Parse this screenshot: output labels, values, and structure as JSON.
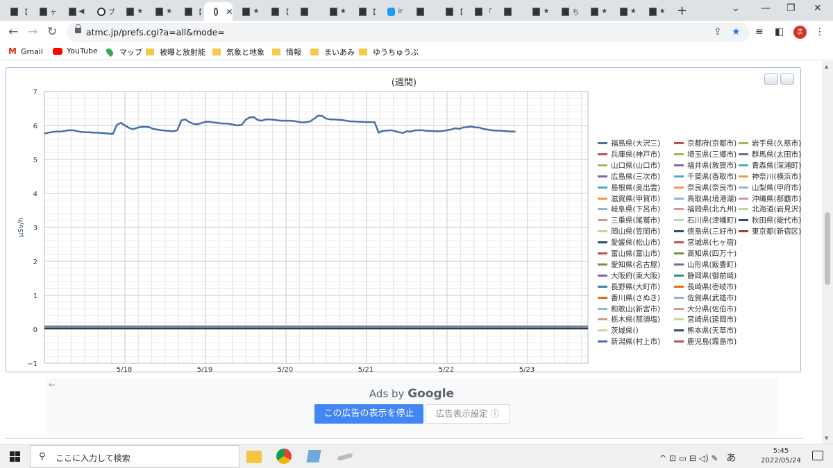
{
  "browser": {
    "tabs": [
      {
        "title": "【",
        "icon": "favicon-dark"
      },
      {
        "title": "ヶ",
        "icon": "favicon-dark"
      },
      {
        "title": "◀",
        "icon": "favicon-dark"
      },
      {
        "title": "ブ",
        "icon": "info-icon"
      },
      {
        "title": "★",
        "icon": "favicon-dark"
      },
      {
        "title": "★",
        "icon": "favicon-dark"
      },
      {
        "title": "【",
        "icon": "favicon-dark"
      },
      {
        "title": "",
        "icon": "globe-icon",
        "active": true
      },
      {
        "title": "★",
        "icon": "favicon-dark"
      },
      {
        "title": "【",
        "icon": "favicon-dark"
      },
      {
        "title": "",
        "icon": "favicon-dark"
      },
      {
        "title": "★",
        "icon": "favicon-dark"
      },
      {
        "title": "【",
        "icon": "favicon-dark"
      },
      {
        "title": "ir",
        "icon": "twitter-icon"
      },
      {
        "title": "",
        "icon": "favicon-dark"
      },
      {
        "title": "【",
        "icon": "favicon-dark"
      },
      {
        "title": "「",
        "icon": "favicon-dark"
      },
      {
        "title": "",
        "icon": "favicon-dark"
      },
      {
        "title": "★",
        "icon": "favicon-dark"
      },
      {
        "title": "ち",
        "icon": "favicon-dark"
      },
      {
        "title": "★",
        "icon": "favicon-dark"
      },
      {
        "title": "★",
        "icon": "favicon-dark"
      },
      {
        "title": "★",
        "icon": "favicon-dark"
      }
    ],
    "new_tab": "+",
    "window_controls": {
      "minimize": "⌄",
      "minimize2": "—",
      "restore": "❐",
      "close": "✕"
    },
    "url": "atmc.jp/prefs.cgi?a=all&mode=",
    "profile_initial": "ま",
    "bookmarks": [
      {
        "label": "Gmail",
        "icon": "gmail-icon"
      },
      {
        "label": "YouTube",
        "icon": "youtube-icon"
      },
      {
        "label": "マップ",
        "icon": "maps-icon"
      },
      {
        "label": "被曝と放射能",
        "icon": "folder-icon"
      },
      {
        "label": "気象と地象",
        "icon": "folder-icon"
      },
      {
        "label": "情報",
        "icon": "folder-icon"
      },
      {
        "label": "まいあみ",
        "icon": "folder-icon"
      },
      {
        "label": "ゆうちゅうぶ",
        "icon": "folder-icon"
      }
    ]
  },
  "chart_data": {
    "type": "line",
    "title": "(週間)",
    "ylabel": "μSv/h",
    "ylim": [
      -1,
      7
    ],
    "yticks": [
      "7",
      "6",
      "5",
      "4",
      "3",
      "2",
      "1",
      "0",
      "−1"
    ],
    "xticks": [
      "5/18",
      "5/19",
      "5/20",
      "5/21",
      "5/22",
      "5/23"
    ],
    "grid": true,
    "legend_position": "right",
    "main_series": {
      "name": "福島県(大沢三)",
      "color": "#4a6fa5",
      "x": [
        0,
        0.05,
        0.1,
        0.15,
        0.2,
        0.25,
        0.3,
        0.35,
        0.4,
        0.45,
        0.5,
        0.55,
        0.6,
        0.65,
        0.7,
        0.75,
        0.8,
        0.85,
        0.9,
        0.95,
        1.0,
        1.05,
        1.1,
        1.15,
        1.2,
        1.25,
        1.3,
        1.35,
        1.4,
        1.45,
        1.5,
        1.55,
        1.6,
        1.65,
        1.7,
        1.75,
        1.8,
        1.85,
        1.9,
        1.95,
        2.0,
        2.05,
        2.1,
        2.15,
        2.2,
        2.25,
        2.3,
        2.35,
        2.4,
        2.45,
        2.5,
        2.55,
        2.6,
        2.65,
        2.7,
        2.75,
        2.8,
        2.85,
        2.9,
        2.95,
        3.0,
        3.05,
        3.1,
        3.15,
        3.2,
        3.25,
        3.3,
        3.35,
        3.4,
        3.45,
        3.5,
        3.55,
        3.6,
        3.65,
        3.7,
        3.75,
        3.8,
        3.85,
        3.9,
        3.95,
        4.0,
        4.05,
        4.1,
        4.15,
        4.2,
        4.25,
        4.3,
        4.35,
        4.4,
        4.45,
        4.5,
        4.55,
        4.6,
        4.65,
        4.7,
        4.75,
        4.8,
        4.85,
        4.9,
        4.95,
        5.0,
        5.05,
        5.1,
        5.15,
        5.2,
        5.25,
        5.3,
        5.35,
        5.4,
        5.45,
        5.5,
        5.55,
        5.6,
        5.65,
        5.7,
        5.75,
        5.8,
        5.85,
        5.9,
        5.95,
        6.0,
        6.05,
        6.1,
        6.15,
        6.2,
        6.25,
        6.3,
        6.35,
        6.4,
        6.45,
        6.5,
        6.55,
        6.6,
        6.65,
        6.7
      ],
      "y": [
        5.76,
        5.79,
        5.81,
        5.82,
        5.82,
        5.84,
        5.86,
        5.86,
        5.84,
        5.81,
        5.8,
        5.8,
        5.79,
        5.79,
        5.78,
        5.77,
        5.76,
        5.75,
        6.02,
        6.08,
        6.0,
        5.93,
        5.89,
        5.93,
        5.96,
        5.96,
        5.95,
        5.9,
        5.88,
        5.86,
        5.85,
        5.84,
        5.83,
        5.86,
        6.15,
        6.18,
        6.1,
        6.05,
        6.04,
        6.07,
        6.11,
        6.11,
        6.09,
        6.08,
        6.06,
        6.06,
        6.05,
        6.02,
        6.0,
        6.02,
        6.17,
        6.24,
        6.25,
        6.16,
        6.14,
        6.18,
        6.18,
        6.17,
        6.15,
        6.14,
        6.14,
        6.14,
        6.13,
        6.11,
        6.09,
        6.1,
        6.12,
        6.2,
        6.29,
        6.28,
        6.2,
        6.18,
        6.18,
        6.17,
        6.16,
        6.14,
        6.12,
        6.12,
        6.11,
        6.11,
        6.1,
        6.1,
        6.1,
        5.79,
        5.84,
        5.85,
        5.86,
        5.84,
        5.8,
        5.78,
        5.83,
        5.82,
        5.86,
        5.86,
        5.86,
        5.84,
        5.84,
        5.83,
        5.83,
        5.84,
        5.86,
        5.88,
        5.92,
        5.9,
        5.94,
        5.95,
        5.97,
        5.94,
        5.94,
        5.9,
        5.88,
        5.86,
        5.85,
        5.85,
        5.84,
        5.83,
        5.82,
        5.82
      ],
      "x_domain": [
        0,
        6.75
      ],
      "x_tick_positions": [
        1,
        2,
        3,
        4,
        5,
        6
      ]
    },
    "near_zero_series_colors": [
      "#c0504d",
      "#9bbb59",
      "#8064a2",
      "#4bacc6",
      "#f79646",
      "#4f81bd",
      "#7f7f7f"
    ]
  },
  "chart_controls": {
    "print": "print-icon",
    "download": "download-icon"
  },
  "legend": {
    "col1": [
      {
        "label": "福島県(大沢三)",
        "color": "#4a6fa5"
      },
      {
        "label": "兵庫県(神戸市)",
        "color": "#c0504d"
      },
      {
        "label": "山口県(山口市)",
        "color": "#9bbb59"
      },
      {
        "label": "広島県(三次市)",
        "color": "#8064a2"
      },
      {
        "label": "島根県(奥出雲)",
        "color": "#4bacc6"
      },
      {
        "label": "滋賀県(甲賀市)",
        "color": "#f79646"
      },
      {
        "label": "岐阜県(下呂市)",
        "color": "#95b3d7"
      },
      {
        "label": "三重県(尾鷲市)",
        "color": "#d99694"
      },
      {
        "label": "岡山県(笠岡市)",
        "color": "#c3d69b"
      },
      {
        "label": "愛媛県(松山市)",
        "color": "#2c4d75"
      },
      {
        "label": "富山県(富山市)",
        "color": "#c0504d"
      },
      {
        "label": "愛知県(名古屋)",
        "color": "#77933c"
      },
      {
        "label": "大阪府(東大阪)",
        "color": "#8064a2"
      },
      {
        "label": "長野県(大町市)",
        "color": "#31859c"
      },
      {
        "label": "香川県(さぬき)",
        "color": "#e46c0a"
      },
      {
        "label": "和歌山(新宮市)",
        "color": "#95b3d7"
      },
      {
        "label": "栃木県(那須塩)",
        "color": "#d99694"
      },
      {
        "label": "茨城県()",
        "color": "#c3d69b"
      },
      {
        "label": "新潟県(村上市)",
        "color": "#4a6fa5"
      }
    ],
    "col2": [
      {
        "label": "京都府(京都市)",
        "color": "#c0504d"
      },
      {
        "label": "埼玉県(三郷市)",
        "color": "#9bbb59"
      },
      {
        "label": "福井県(敦賀市)",
        "color": "#8064a2"
      },
      {
        "label": "千葉県(香取市)",
        "color": "#4bacc6"
      },
      {
        "label": "奈良県(奈良市)",
        "color": "#f79646"
      },
      {
        "label": "鳥取県(境港湖)",
        "color": "#95b3d7"
      },
      {
        "label": "福岡県(北九州)",
        "color": "#d99694"
      },
      {
        "label": "石川県(津幡町)",
        "color": "#c3d69b"
      },
      {
        "label": "徳島県(三好市)",
        "color": "#2c4d75"
      },
      {
        "label": "宮城県(七ヶ宿)",
        "color": "#c0504d"
      },
      {
        "label": "高知県(四万十)",
        "color": "#77933c"
      },
      {
        "label": "山形県(飯豊町)",
        "color": "#8064a2"
      },
      {
        "label": "静岡県(御前崎)",
        "color": "#31859c"
      },
      {
        "label": "長崎県(壱岐市)",
        "color": "#e46c0a"
      },
      {
        "label": "佐賀県(武雄市)",
        "color": "#95b3d7"
      },
      {
        "label": "大分県(佐伯市)",
        "color": "#d99694"
      },
      {
        "label": "宮崎県(延岡市)",
        "color": "#c3d69b"
      },
      {
        "label": "熊本県(天草市)",
        "color": "#2c4d75"
      },
      {
        "label": "鹿児島(霧島市)",
        "color": "#c0504d"
      }
    ],
    "col3": [
      {
        "label": "岩手県(久慈市)",
        "color": "#9bbb59"
      },
      {
        "label": "群馬県(太田市)",
        "color": "#8064a2"
      },
      {
        "label": "青森県(深浦町)",
        "color": "#4bacc6"
      },
      {
        "label": "神奈川(横浜市)",
        "color": "#f79646"
      },
      {
        "label": "山梨県(甲府市)",
        "color": "#95b3d7"
      },
      {
        "label": "沖縄県(那覇市)",
        "color": "#d99694"
      },
      {
        "label": "北海道(岩見沢)",
        "color": "#c3d69b"
      },
      {
        "label": "秋田県(能代市)",
        "color": "#2c4d75"
      },
      {
        "label": "東京都(新宿区)",
        "color": "#a0403d"
      }
    ]
  },
  "ad": {
    "ads_by": "Ads by",
    "google": "Google",
    "stop_button": "この広告の表示を停止",
    "settings_button": "広告表示設定 ⓘ",
    "back": "←"
  },
  "taskbar": {
    "search_placeholder": "ここに入力して検索",
    "time": "5:45",
    "date": "2022/05/24",
    "ime": "あ",
    "tray_icons": "^ ⊡ ▭ ⊟ ◁) ✎"
  }
}
